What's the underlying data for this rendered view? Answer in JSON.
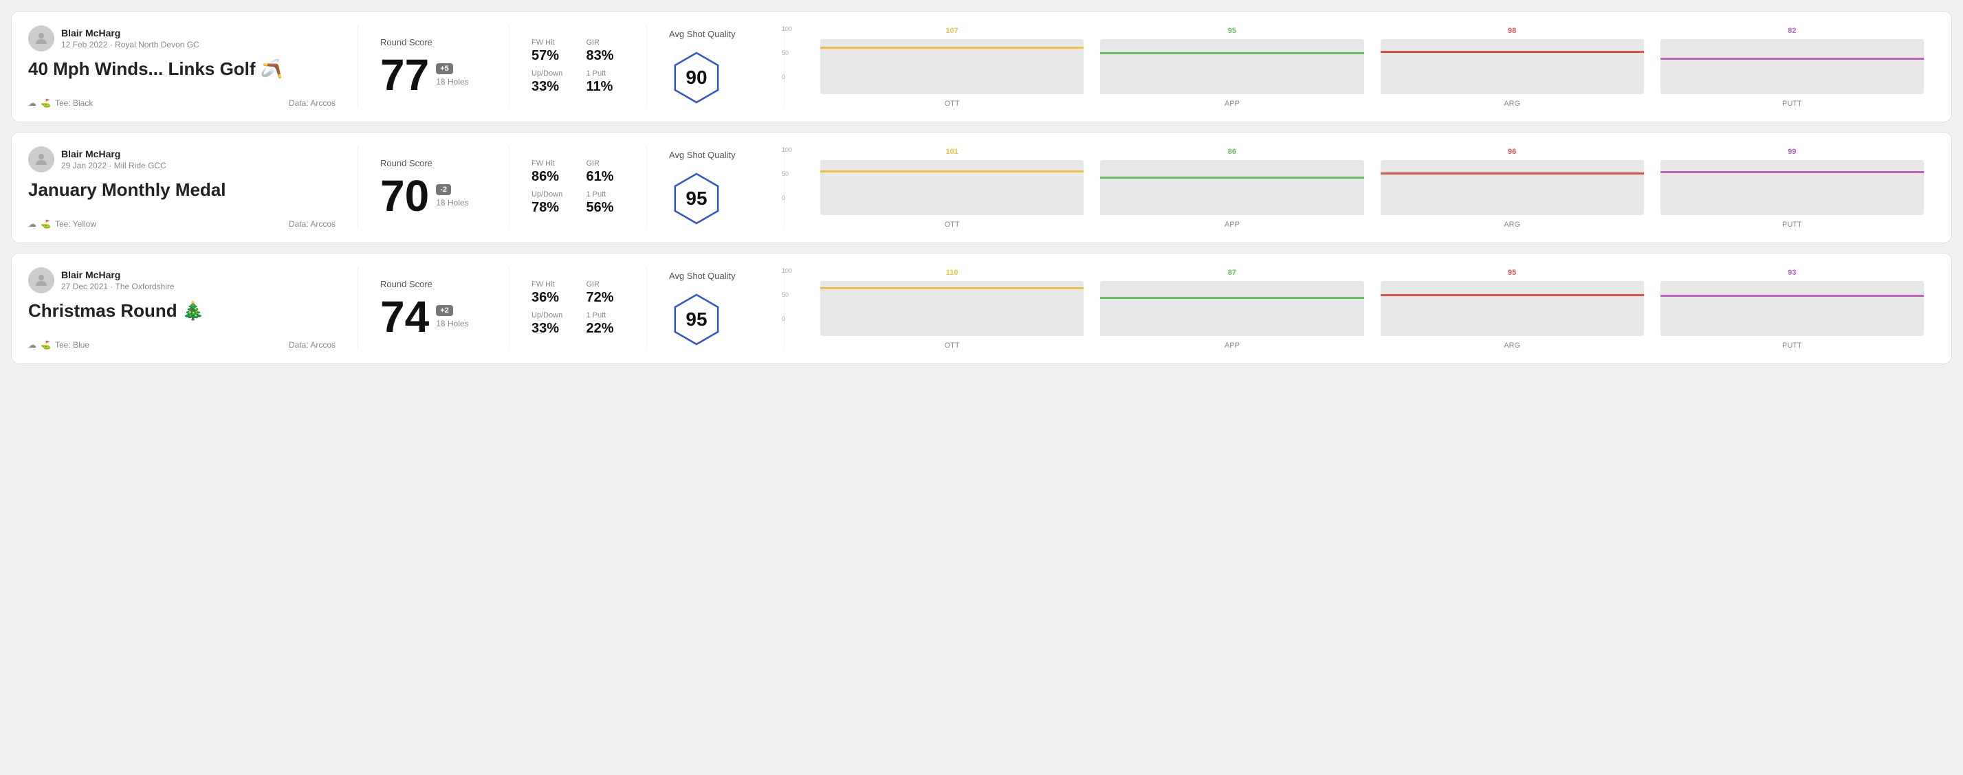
{
  "rounds": [
    {
      "id": "round1",
      "player": {
        "name": "Blair McHarg",
        "meta": "12 Feb 2022 · Royal North Devon GC"
      },
      "title": "40 Mph Winds... Links Golf",
      "title_emoji": "🪃",
      "tee": "Black",
      "data_source": "Data: Arccos",
      "score": {
        "label": "Round Score",
        "number": "77",
        "modifier": "+5",
        "holes": "18 Holes"
      },
      "stats": {
        "fw_hit_label": "FW Hit",
        "fw_hit_value": "57%",
        "gir_label": "GIR",
        "gir_value": "83%",
        "updown_label": "Up/Down",
        "updown_value": "33%",
        "oneputt_label": "1 Putt",
        "oneputt_value": "11%"
      },
      "quality": {
        "label": "Avg Shot Quality",
        "score": "90"
      },
      "chart": {
        "bars": [
          {
            "label": "OTT",
            "value": 107,
            "color": "#f0c040",
            "max": 130
          },
          {
            "label": "APP",
            "value": 95,
            "color": "#60c060",
            "max": 130
          },
          {
            "label": "ARG",
            "value": 98,
            "color": "#e05050",
            "max": 130
          },
          {
            "label": "PUTT",
            "value": 82,
            "color": "#c060c0",
            "max": 130
          }
        ]
      }
    },
    {
      "id": "round2",
      "player": {
        "name": "Blair McHarg",
        "meta": "29 Jan 2022 · Mill Ride GCC"
      },
      "title": "January Monthly Medal",
      "title_emoji": "",
      "tee": "Yellow",
      "data_source": "Data: Arccos",
      "score": {
        "label": "Round Score",
        "number": "70",
        "modifier": "-2",
        "holes": "18 Holes"
      },
      "stats": {
        "fw_hit_label": "FW Hit",
        "fw_hit_value": "86%",
        "gir_label": "GIR",
        "gir_value": "61%",
        "updown_label": "Up/Down",
        "updown_value": "78%",
        "oneputt_label": "1 Putt",
        "oneputt_value": "56%"
      },
      "quality": {
        "label": "Avg Shot Quality",
        "score": "95"
      },
      "chart": {
        "bars": [
          {
            "label": "OTT",
            "value": 101,
            "color": "#f0c040",
            "max": 130
          },
          {
            "label": "APP",
            "value": 86,
            "color": "#60c060",
            "max": 130
          },
          {
            "label": "ARG",
            "value": 96,
            "color": "#e05050",
            "max": 130
          },
          {
            "label": "PUTT",
            "value": 99,
            "color": "#c060c0",
            "max": 130
          }
        ]
      }
    },
    {
      "id": "round3",
      "player": {
        "name": "Blair McHarg",
        "meta": "27 Dec 2021 · The Oxfordshire"
      },
      "title": "Christmas Round",
      "title_emoji": "🎄",
      "tee": "Blue",
      "data_source": "Data: Arccos",
      "score": {
        "label": "Round Score",
        "number": "74",
        "modifier": "+2",
        "holes": "18 Holes"
      },
      "stats": {
        "fw_hit_label": "FW Hit",
        "fw_hit_value": "36%",
        "gir_label": "GIR",
        "gir_value": "72%",
        "updown_label": "Up/Down",
        "updown_value": "33%",
        "oneputt_label": "1 Putt",
        "oneputt_value": "22%"
      },
      "quality": {
        "label": "Avg Shot Quality",
        "score": "95"
      },
      "chart": {
        "bars": [
          {
            "label": "OTT",
            "value": 110,
            "color": "#f0c040",
            "max": 130
          },
          {
            "label": "APP",
            "value": 87,
            "color": "#60c060",
            "max": 130
          },
          {
            "label": "ARG",
            "value": 95,
            "color": "#e05050",
            "max": 130
          },
          {
            "label": "PUTT",
            "value": 93,
            "color": "#c060c0",
            "max": 130
          }
        ]
      }
    }
  ],
  "ui": {
    "y_axis_labels": [
      "100",
      "50",
      "0"
    ]
  }
}
